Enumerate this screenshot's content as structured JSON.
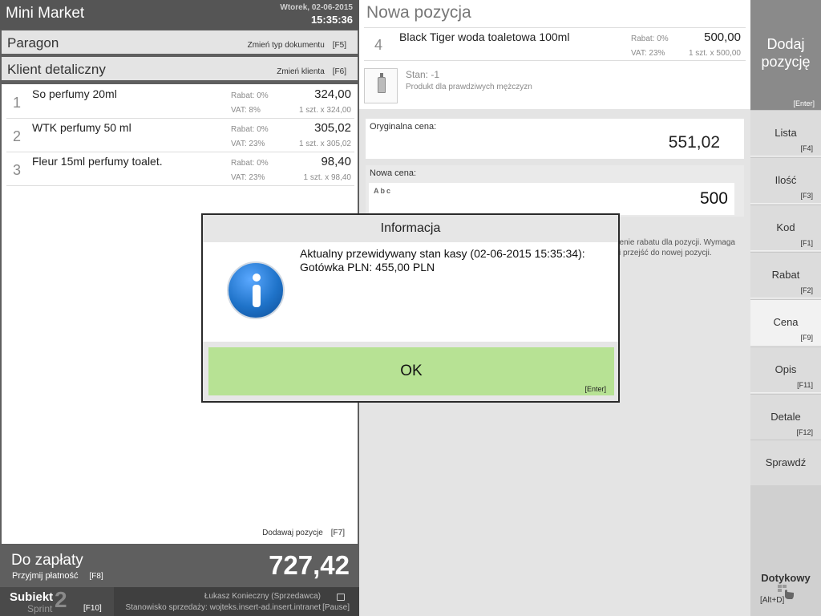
{
  "app": {
    "title": "Mini Market",
    "date": "Wtorek, 02-06-2015",
    "time": "15:35:36"
  },
  "document": {
    "type_label": "Paragon",
    "change_type_label": "Zmień typ dokumentu",
    "change_type_key": "[F5]",
    "client_label": "Klient detaliczny",
    "change_client_label": "Zmień klienta",
    "change_client_key": "[F6]"
  },
  "items": [
    {
      "num": "1",
      "name": "So perfumy 20ml",
      "rabat": "Rabat:  0%",
      "vat": "VAT:  8%",
      "price": "324,00",
      "qty": "1 szt. x 324,00"
    },
    {
      "num": "2",
      "name": "WTK perfumy 50 ml",
      "rabat": "Rabat:  0%",
      "vat": "VAT:  23%",
      "price": "305,02",
      "qty": "1 szt. x 305,02"
    },
    {
      "num": "3",
      "name": "Fleur 15ml perfumy toalet.",
      "rabat": "Rabat:  0%",
      "vat": "VAT:  23%",
      "price": "98,40",
      "qty": "1 szt. x 98,40"
    }
  ],
  "add_position": {
    "label": "Dodawaj pozycje",
    "key": "[F7]"
  },
  "payment": {
    "label": "Do zapłaty",
    "accept_label": "Przyjmij płatność",
    "accept_key": "[F8]",
    "total": "727,42"
  },
  "footer": {
    "brand": "Subiekt",
    "brand_number": "2",
    "brand_sub": "Sprint",
    "brand_key": "[F10]",
    "user": "Łukasz Konieczny (Sprzedawca)",
    "station": "Stanowisko sprzedaży: wojteks.insert-ad.insert.intranet",
    "pause_key": "[Pause]"
  },
  "new_position": {
    "title": "Nowa pozycja",
    "num": "4",
    "name": "Black Tiger woda toaletowa 100ml",
    "rabat": "Rabat:  0%",
    "vat": "VAT:  23%",
    "price": "500,00",
    "qty": "1 szt. x 500,00",
    "stock": "Stan: -1",
    "description": "Produkt dla prawdziwych mężczyzn",
    "original_price_label": "Oryginalna cena:",
    "original_price": "551,02",
    "new_price_label": "Nowa cena:",
    "new_price_value": "500",
    "abc_label": "Abc",
    "hint_line1": "dzenie rabatu dla pozycji. Wymaga",
    "hint_line2": "ić i przejść do nowej pozycji."
  },
  "sidebar": {
    "add": {
      "label_line1": "Dodaj",
      "label_line2": "pozycję",
      "key": "[Enter]"
    },
    "buttons": [
      {
        "label": "Lista",
        "key": "[F4]"
      },
      {
        "label": "Ilość",
        "key": "[F3]"
      },
      {
        "label": "Kod",
        "key": "[F1]"
      },
      {
        "label": "Rabat",
        "key": "[F2]"
      },
      {
        "label": "Cena",
        "key": "[F9]"
      },
      {
        "label": "Opis",
        "key": "[F11]"
      },
      {
        "label": "Detale",
        "key": "[F12]"
      },
      {
        "label": "Sprawdź",
        "key": ""
      }
    ],
    "touch": {
      "label": "Dotykowy",
      "key": "[Alt+D]"
    }
  },
  "dialog": {
    "title": "Informacja",
    "message_line1": "Aktualny przewidywany stan kasy (02-06-2015 15:35:34):",
    "message_line2": "Gotówka PLN: 455,00 PLN",
    "ok_label": "OK",
    "ok_key": "[Enter]",
    "icon": "info-icon"
  },
  "colors": {
    "ok_button": "#b7e294",
    "header_dark": "#555555",
    "info_icon": "#1f73c9"
  }
}
